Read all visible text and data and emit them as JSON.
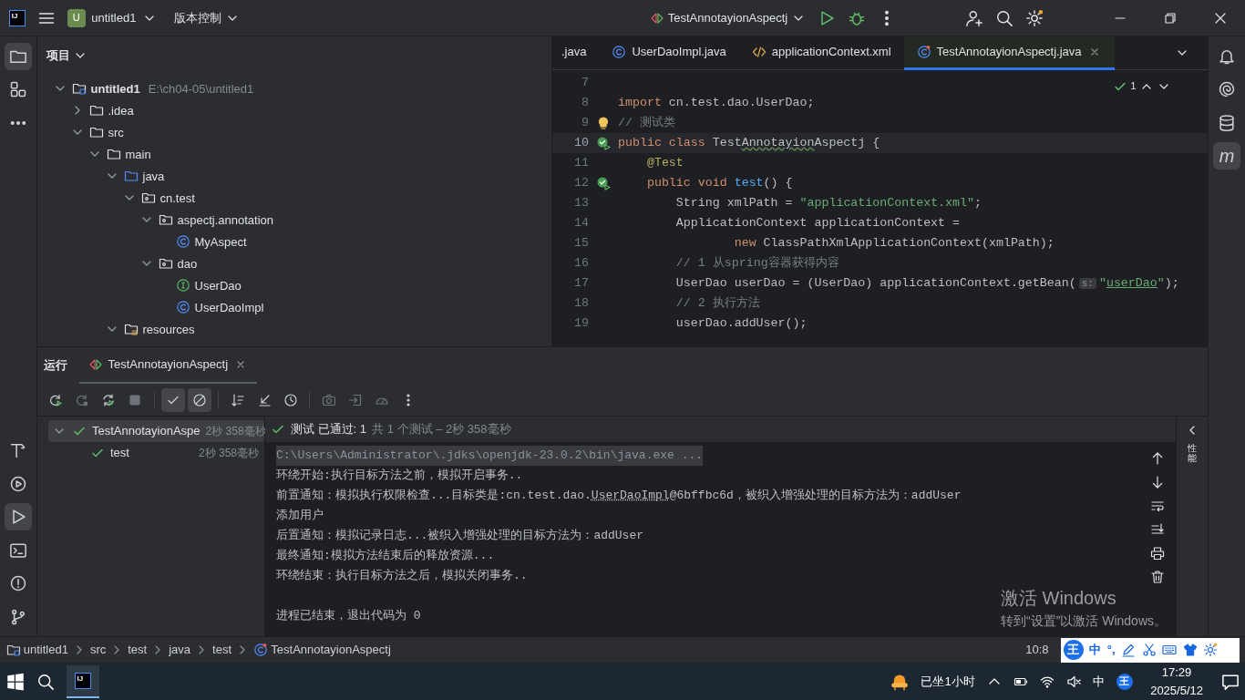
{
  "title_bar": {
    "logo": "IJ",
    "project_badge": "U",
    "project": "untitled1",
    "vcs": "版本控制",
    "run_config": "TestAnnotayionAspectj"
  },
  "left_toolbar": [
    {
      "kind": "folder",
      "selected": true
    },
    {
      "kind": "blocks",
      "selected": false
    },
    {
      "kind": "dots",
      "selected": false
    }
  ],
  "left_toolbar_bottom": [
    {
      "kind": "hammer",
      "selected": false
    },
    {
      "kind": "playcircle",
      "selected": false
    },
    {
      "kind": "play",
      "selected": true
    },
    {
      "kind": "terminal",
      "selected": false
    },
    {
      "kind": "alert",
      "selected": false
    },
    {
      "kind": "branch",
      "selected": false
    }
  ],
  "project_panel": {
    "title": "项目",
    "tree": [
      {
        "kind": "module",
        "label": "untitled1",
        "path": "E:\\ch04-05\\untitled1",
        "expanded": true,
        "children": [
          {
            "kind": "folder",
            "label": ".idea",
            "expanded": false
          },
          {
            "kind": "folder",
            "label": "src",
            "expanded": true,
            "children": [
              {
                "kind": "folder",
                "label": "main",
                "expanded": true,
                "children": [
                  {
                    "kind": "source",
                    "label": "java",
                    "expanded": true,
                    "children": [
                      {
                        "kind": "package",
                        "label": "cn.test",
                        "expanded": true,
                        "children": [
                          {
                            "kind": "package",
                            "label": "aspectj.annotation",
                            "expanded": true,
                            "children": [
                              {
                                "kind": "class",
                                "label": "MyAspect"
                              }
                            ]
                          },
                          {
                            "kind": "package",
                            "label": "dao",
                            "expanded": true,
                            "children": [
                              {
                                "kind": "interface",
                                "label": "UserDao"
                              },
                              {
                                "kind": "class",
                                "label": "UserDaoImpl"
                              }
                            ]
                          }
                        ]
                      }
                    ]
                  },
                  {
                    "kind": "resources",
                    "label": "resources",
                    "expanded": true
                  }
                ]
              }
            ]
          }
        ]
      }
    ]
  },
  "editor": {
    "tabs": [
      {
        "kind": "partial",
        "label": ".java",
        "selected": false
      },
      {
        "kind": "class",
        "label": "UserDaoImpl.java",
        "selected": false
      },
      {
        "kind": "xml",
        "label": "applicationContext.xml",
        "selected": false
      },
      {
        "kind": "test",
        "label": "TestAnnotayionAspectj.java",
        "selected": true
      }
    ],
    "inspection_count": "1",
    "lines": [
      {
        "number": "7",
        "current": false,
        "run_marker": false,
        "intention": false
      },
      {
        "number": "8",
        "current": false,
        "run_marker": false,
        "intention": false,
        "tokens": [
          {
            "kind": "keyword",
            "text": "import "
          },
          {
            "kind": "plain",
            "text": "cn.test.dao.UserDao;"
          }
        ]
      },
      {
        "number": "9",
        "current": false,
        "run_marker": false,
        "intention": true,
        "tokens": [
          {
            "kind": "comment",
            "text": "// 测试类"
          }
        ]
      },
      {
        "number": "10",
        "current": true,
        "run_marker": true,
        "intention": false,
        "tokens": [
          {
            "kind": "keyword",
            "text": "public class "
          },
          {
            "kind": "plain",
            "text": "Test"
          },
          {
            "kind": "typo",
            "text": "Annotayion"
          },
          {
            "kind": "plain",
            "text": "Aspectj {"
          }
        ]
      },
      {
        "number": "11",
        "current": false,
        "run_marker": false,
        "intention": false,
        "tokens": [
          {
            "kind": "annotation",
            "text": "    @Test"
          }
        ]
      },
      {
        "number": "12",
        "current": false,
        "run_marker": true,
        "intention": false,
        "tokens": [
          {
            "kind": "keyword",
            "text": "    public void "
          },
          {
            "kind": "method",
            "text": "test"
          },
          {
            "kind": "plain",
            "text": "() {"
          }
        ]
      },
      {
        "number": "13",
        "current": false,
        "run_marker": false,
        "intention": false,
        "tokens": [
          {
            "kind": "plain",
            "text": "        String xmlPath = "
          },
          {
            "kind": "string",
            "text": "\"applicationContext.xml\""
          },
          {
            "kind": "plain",
            "text": ";"
          }
        ]
      },
      {
        "number": "14",
        "current": false,
        "run_marker": false,
        "intention": false,
        "tokens": [
          {
            "kind": "plain",
            "text": "        ApplicationContext applicationContext ="
          }
        ]
      },
      {
        "number": "15",
        "current": false,
        "run_marker": false,
        "intention": false,
        "tokens": [
          {
            "kind": "keyword",
            "text": "                new "
          },
          {
            "kind": "plain",
            "text": "ClassPathXmlApplicationContext(xmlPath);"
          }
        ]
      },
      {
        "number": "16",
        "current": false,
        "run_marker": false,
        "intention": false,
        "tokens": [
          {
            "kind": "comment",
            "text": "        // 1 从spring容器获得内容"
          }
        ]
      },
      {
        "number": "17",
        "current": false,
        "run_marker": false,
        "intention": false,
        "tokens": [
          {
            "kind": "plain",
            "text": "        UserDao userDao = (UserDao) applicationContext.getBean("
          },
          {
            "kind": "hint",
            "text": "s:"
          },
          {
            "kind": "string",
            "text": "\""
          },
          {
            "kind": "string_ref",
            "text": "userDao"
          },
          {
            "kind": "string",
            "text": "\""
          },
          {
            "kind": "plain",
            "text": ");"
          }
        ]
      },
      {
        "number": "18",
        "current": false,
        "run_marker": false,
        "intention": false,
        "tokens": [
          {
            "kind": "comment",
            "text": "        // 2 执行方法"
          }
        ]
      },
      {
        "number": "19",
        "current": false,
        "run_marker": false,
        "intention": false,
        "tokens": [
          {
            "kind": "plain",
            "text": "        userDao.addUser();"
          }
        ]
      }
    ]
  },
  "right_toolbar": [
    {
      "kind": "bell",
      "selected": false
    },
    {
      "kind": "spiral",
      "selected": false
    },
    {
      "kind": "database",
      "selected": false
    },
    {
      "kind": "letter",
      "label": "m",
      "selected": true
    }
  ],
  "run_panel": {
    "title": "运行",
    "tab": "TestAnnotayionAspectj",
    "toolbar": [
      {
        "kind": "rerun",
        "selected": false,
        "disabled": false
      },
      {
        "kind": "rerun_failed",
        "selected": false,
        "disabled": true
      },
      {
        "kind": "toggle_auto",
        "selected": false,
        "disabled": false
      },
      {
        "kind": "stop",
        "selected": false,
        "disabled": true
      },
      {
        "kind": "check",
        "selected": true,
        "disabled": false
      },
      {
        "kind": "ban",
        "selected": true,
        "disabled": false
      },
      {
        "kind": "sort",
        "selected": false,
        "disabled": false
      },
      {
        "kind": "collapse",
        "selected": false,
        "disabled": false
      },
      {
        "kind": "clock",
        "selected": false,
        "disabled": false
      },
      {
        "kind": "camera",
        "selected": false,
        "disabled": true
      },
      {
        "kind": "import",
        "selected": false,
        "disabled": true
      },
      {
        "kind": "gauge",
        "selected": false,
        "disabled": true
      },
      {
        "kind": "vdots",
        "selected": false,
        "disabled": false
      }
    ],
    "tests": [
      {
        "label": "TestAnnotayionAspe",
        "time": "2秒 358毫秒",
        "passed": true,
        "selected": true,
        "expanded": true,
        "children": [
          {
            "label": "test",
            "time": "2秒 358毫秒",
            "passed": true,
            "selected": false
          }
        ]
      }
    ],
    "summary": {
      "passed": true,
      "status": "测试 已通过: 1",
      "detail": "共 1 个测试 – 2秒 358毫秒"
    },
    "console": [
      {
        "kind": "command",
        "segments": [
          {
            "kind": "text",
            "text": "C:\\Users\\Administrator\\.jdks\\openjdk-23.0.2\\bin\\java.exe ..."
          }
        ]
      },
      {
        "kind": "output",
        "segments": [
          {
            "kind": "text",
            "text": "环绕开始:执行目标方法之前，模拟开启事务.."
          }
        ]
      },
      {
        "kind": "output",
        "segments": [
          {
            "kind": "text",
            "text": "前置通知：模拟执行权限检查...目标类是:cn.test.dao."
          },
          {
            "kind": "link",
            "text": "UserDaoImpl"
          },
          {
            "kind": "text",
            "text": "@6bffbc6d，被织入增强处理的目标方法为：addUser"
          }
        ]
      },
      {
        "kind": "output",
        "segments": [
          {
            "kind": "text",
            "text": "添加用户"
          }
        ]
      },
      {
        "kind": "output",
        "segments": [
          {
            "kind": "text",
            "text": "后置通知：模拟记录日志...被织入增强处理的目标方法为：addUser"
          }
        ]
      },
      {
        "kind": "output",
        "segments": [
          {
            "kind": "text",
            "text": "最终通知:模拟方法结束后的释放资源..."
          }
        ]
      },
      {
        "kind": "output",
        "segments": [
          {
            "kind": "text",
            "text": "环绕结束：执行目标方法之后，模拟关闭事务.."
          }
        ]
      },
      {
        "kind": "blank"
      },
      {
        "kind": "output",
        "segments": [
          {
            "kind": "text",
            "text": "进程已结束，退出代码为 0"
          }
        ]
      }
    ],
    "side_label": "性能"
  },
  "activation_notice": {
    "title": "激活 Windows",
    "detail": "转到“设置”以激活 Windows。"
  },
  "status_bar": {
    "breadcrumbs": [
      {
        "kind": "module",
        "label": "untitled1"
      },
      {
        "kind": "folder",
        "label": "src"
      },
      {
        "kind": "folder",
        "label": "test"
      },
      {
        "kind": "folder",
        "label": "java"
      },
      {
        "kind": "folder",
        "label": "test"
      },
      {
        "kind": "test",
        "label": "TestAnnotayionAspectj"
      }
    ],
    "position": "10:8"
  },
  "ime_toolbar": {
    "logo": "王",
    "mode": "中",
    "punctuation": "°,"
  },
  "taskbar": {
    "app_logo": "IJ",
    "app_selected": true,
    "reminder": "已坐1小时",
    "ime_mode": "中",
    "ime_logo": "王",
    "time": "17:29",
    "date": "2025/5/12"
  }
}
